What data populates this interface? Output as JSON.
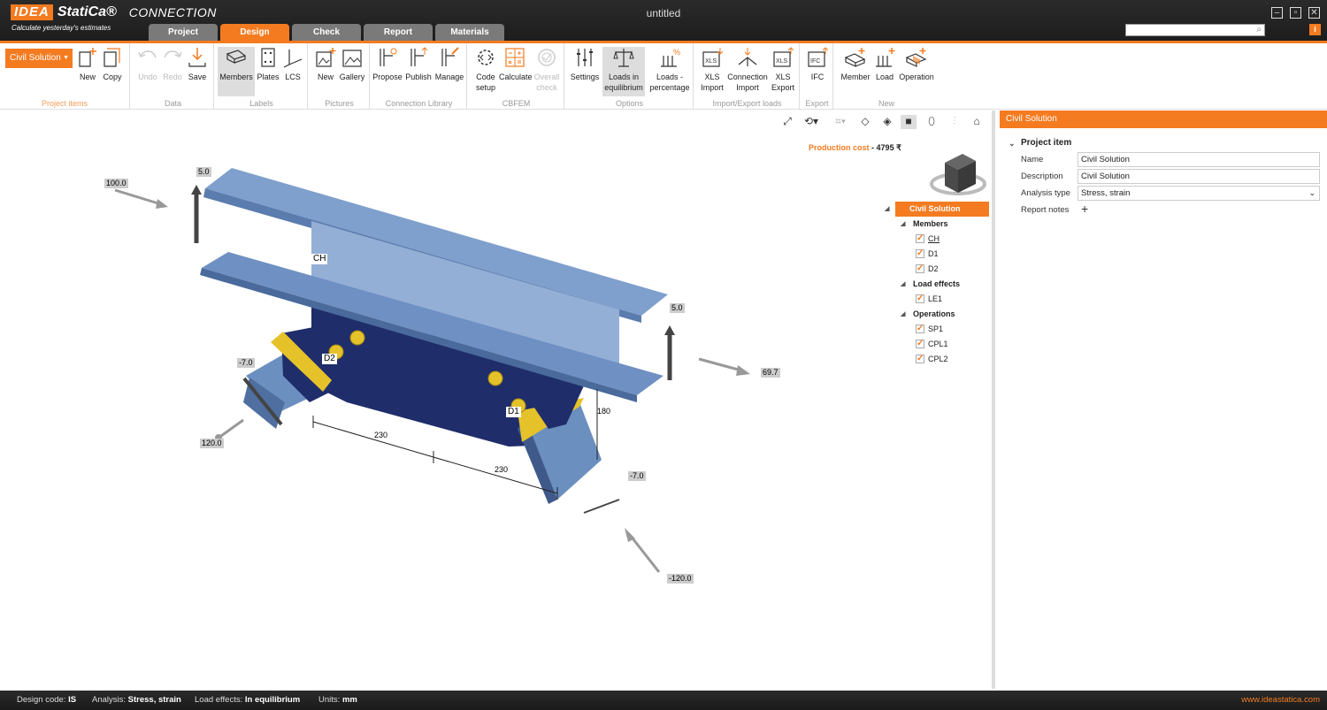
{
  "app": {
    "logo_idea": "IDEA",
    "logo_statica": "StatiCa®",
    "product": "CONNECTION",
    "slogan": "Calculate yesterday's estimates",
    "document_title": "untitled"
  },
  "tabs": [
    {
      "label": "Project"
    },
    {
      "label": "Design",
      "active": true
    },
    {
      "label": "Check"
    },
    {
      "label": "Report"
    },
    {
      "label": "Materials"
    }
  ],
  "ribbon": {
    "project_select": "Civil Solution",
    "groups": {
      "project_items": "Project items",
      "data": "Data",
      "labels": "Labels",
      "pictures": "Pictures",
      "connection_library": "Connection Library",
      "cbfem": "CBFEM",
      "options": "Options",
      "import_export": "Import/Export loads",
      "export": "Export",
      "new": "New"
    },
    "buttons": {
      "new": "New",
      "copy": "Copy",
      "undo": "Undo",
      "redo": "Redo",
      "save": "Save",
      "members": "Members",
      "plates": "Plates",
      "lcs": "LCS",
      "pic_new": "New",
      "gallery": "Gallery",
      "propose": "Propose",
      "publish": "Publish",
      "manage": "Manage",
      "code_setup": "Code setup",
      "calculate": "Calculate",
      "overall_check": "Overall check",
      "settings": "Settings",
      "loads_equilibrium": "Loads in equilibrium",
      "loads_percentage": "Loads - percentage",
      "xls_import": "XLS Import",
      "connection_import": "Connection Import",
      "xls_export": "XLS Export",
      "ifc": "IFC",
      "member": "Member",
      "load": "Load",
      "operation": "Operation"
    }
  },
  "viewport": {
    "production_cost_label": "Production cost",
    "production_cost_sep": "-",
    "production_cost_value": "4795 ₹",
    "members": {
      "ch": "CH",
      "d1": "D1",
      "d2": "D2"
    },
    "loads": [
      "5.0",
      "100.0",
      "5.0",
      "69.7",
      "-7.0",
      "120.0",
      "-7.0",
      "-120.0"
    ],
    "dimensions": [
      "230",
      "230",
      "180"
    ]
  },
  "tree": {
    "root": "Civil Solution",
    "members_label": "Members",
    "members": [
      "CH",
      "D1",
      "D2"
    ],
    "load_effects_label": "Load effects",
    "load_effects": [
      "LE1"
    ],
    "operations_label": "Operations",
    "operations": [
      "SP1",
      "CPL1",
      "CPL2"
    ]
  },
  "properties": {
    "header": "Civil Solution",
    "section": "Project item",
    "name_label": "Name",
    "name_value": "Civil Solution",
    "description_label": "Description",
    "description_value": "Civil Solution",
    "analysis_label": "Analysis type",
    "analysis_value": "Stress, strain",
    "report_notes_label": "Report notes",
    "report_notes_add": "+"
  },
  "status": {
    "design_code_label": "Design code:",
    "design_code": "IS",
    "analysis_label": "Analysis:",
    "analysis": "Stress, strain",
    "load_effects_label": "Load effects:",
    "load_effects": "In equilibrium",
    "units_label": "Units:",
    "units": "mm",
    "url": "www.ideastatica.com"
  },
  "colors": {
    "accent": "#f47b20",
    "beam": "#7f9fcc",
    "plate": "#1f2d6b",
    "weld": "#e5c22a"
  }
}
